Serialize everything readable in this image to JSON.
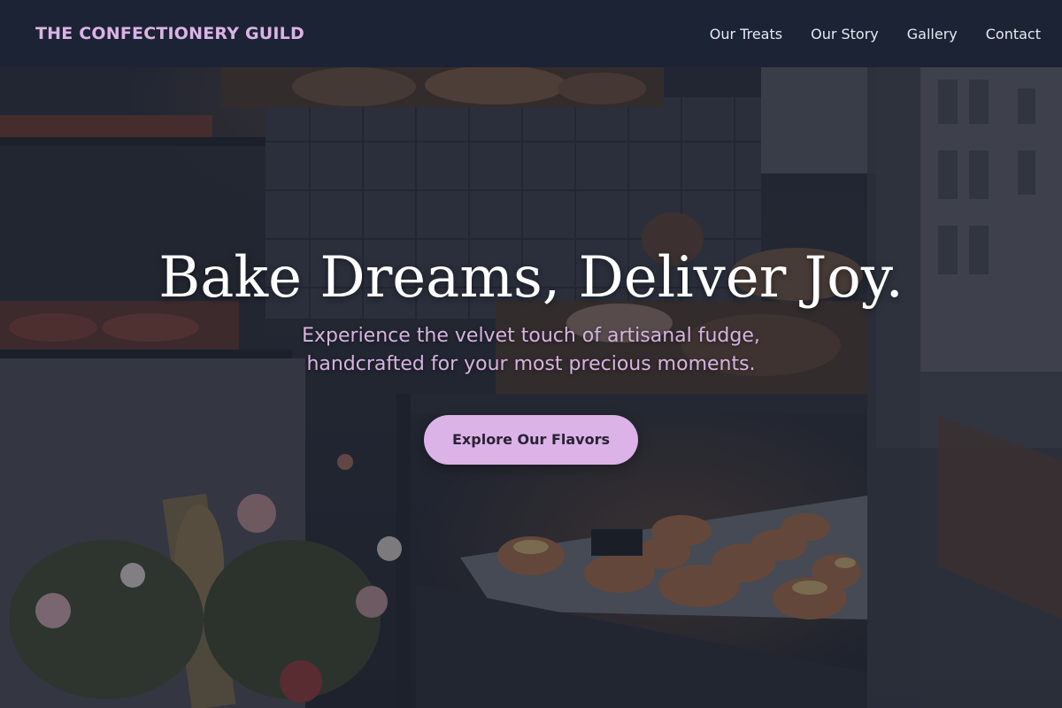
{
  "nav": {
    "brand": "THE CONFECTIONERY GUILD",
    "links": [
      "Our Treats",
      "Our Story",
      "Gallery",
      "Contact"
    ]
  },
  "hero": {
    "title": "Bake Dreams, Deliver Joy.",
    "subtitle": "Experience the velvet touch of artisanal fudge, handcrafted for your most precious moments.",
    "cta_label": "Explore Our Flavors",
    "background_image": "bakery storefront window with pastries on shelves and dried flowers"
  },
  "colors": {
    "accent": "#dcb3e6",
    "nav_background": "#1c2334",
    "nav_text": "#e8eaf0",
    "title_text": "#ffffff",
    "cta_text": "#2a2236"
  }
}
